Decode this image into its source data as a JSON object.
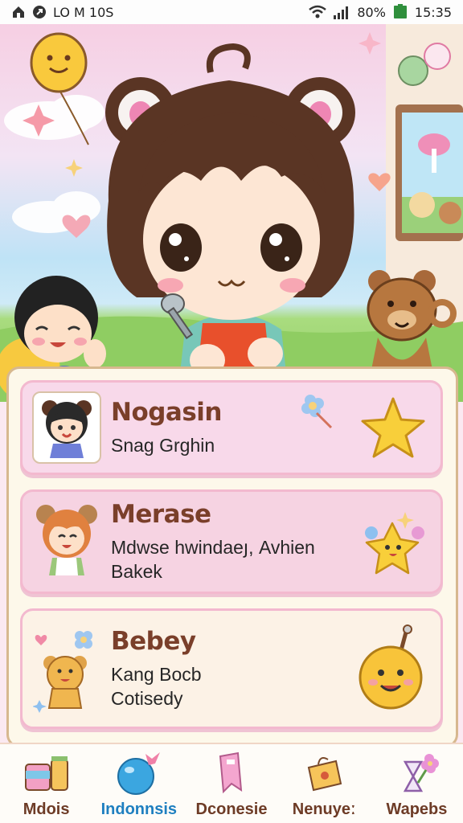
{
  "status_bar": {
    "left_text": "LO M 10S",
    "battery_percent": "80%",
    "time": "15:35",
    "icons": [
      "home-icon",
      "notification-icon",
      "wifi-icon",
      "signal-icon",
      "battery-icon"
    ]
  },
  "hero": {
    "icons": [
      "balloon-icon",
      "sparkle-icon",
      "heart-icon",
      "bear-icon",
      "spoon-icon",
      "window-icon"
    ]
  },
  "cards": [
    {
      "title": "Nogasin",
      "subtitle_lines": [
        "Snag Grghin"
      ],
      "thumb_icon": "avatar-girl-bear-ears-icon",
      "side_icon": "star-icon",
      "deco_icon": "flower-icon"
    },
    {
      "title": "Merase",
      "subtitle_lines": [
        "Mdwse hwindaeյ, Avhien",
        "Bakek"
      ],
      "thumb_icon": "avatar-orange-hair-icon",
      "side_icon": "star-creature-icon"
    },
    {
      "title": "Bebey",
      "subtitle_lines": [
        "Kang Bocb",
        "Cotisedy"
      ],
      "thumb_icon": "teddy-bear-icon",
      "side_icon": "smiley-ball-icon"
    }
  ],
  "nav": {
    "items": [
      {
        "label": "Mdois",
        "icon": "jars-icon",
        "active": false
      },
      {
        "label": "Indonnsis",
        "icon": "ball-icon",
        "active": true
      },
      {
        "label": "Dconesie",
        "icon": "bookmark-icon",
        "active": false
      },
      {
        "label": "Nenuyeː",
        "icon": "bag-icon",
        "active": false
      },
      {
        "label": "Wapebs",
        "icon": "hourglass-flower-icon",
        "active": false
      }
    ]
  },
  "colors": {
    "title": "#7a3f2a",
    "accent_blue": "#1e7fc0",
    "card_border": "#f3b9cf",
    "panel_border": "#d7b88f"
  }
}
